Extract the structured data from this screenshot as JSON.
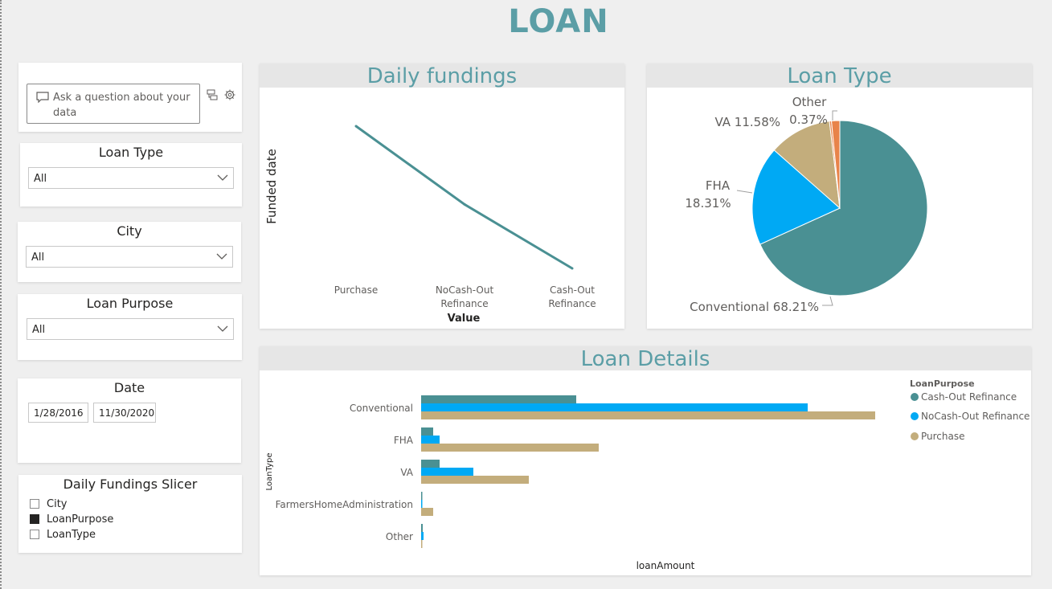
{
  "page_title": "LOAN",
  "qa": {
    "placeholder": "Ask a question about your data"
  },
  "slicers": {
    "loan_type": {
      "title": "Loan Type",
      "value": "All"
    },
    "city": {
      "title": "City",
      "value": "All"
    },
    "loan_purpose": {
      "title": "Loan Purpose",
      "value": "All"
    },
    "date": {
      "title": "Date",
      "start": "1/28/2016",
      "end": "11/30/2020"
    },
    "daily_fundings": {
      "title": "Daily Fundings Slicer",
      "options": [
        {
          "label": "City",
          "checked": false
        },
        {
          "label": "LoanPurpose",
          "checked": true
        },
        {
          "label": "LoanType",
          "checked": false
        }
      ]
    }
  },
  "chart_data": [
    {
      "type": "line",
      "title": "Daily fundings",
      "xlabel": "Value",
      "ylabel": "Funded date",
      "categories": [
        "Purchase",
        "NoCash-Out Refinance",
        "Cash-Out Refinance"
      ],
      "category_lines": [
        [
          "Purchase"
        ],
        [
          "NoCash-Out",
          "Refinance"
        ],
        [
          "Cash-Out",
          "Refinance"
        ]
      ],
      "values": [
        100,
        45,
        0
      ],
      "color": "#4a9093"
    },
    {
      "type": "pie",
      "title": "Loan Type",
      "slices": [
        {
          "label": "Conventional",
          "value": 68.21,
          "pct_label": "68.21%",
          "color": "#4a9093"
        },
        {
          "label": "FHA",
          "value": 18.31,
          "pct_label": "18.31%",
          "color": "#00a9f4"
        },
        {
          "label": "VA",
          "value": 11.58,
          "pct_label": "11.58%",
          "color": "#c3ad7c"
        },
        {
          "label": "Other",
          "value": 0.37,
          "pct_label": "0.37%",
          "color": "#e8834a"
        },
        {
          "label": "",
          "value": 1.53,
          "pct_label": "",
          "color": "#e8834a"
        }
      ]
    },
    {
      "type": "bar",
      "orientation": "horizontal",
      "title": "Loan Details",
      "xlabel": "loanAmount",
      "ylabel": "LoanType",
      "legend_title": "LoanPurpose",
      "legend_position": "right",
      "categories": [
        "Conventional",
        "FHA",
        "VA",
        "FarmersHomeAdministration",
        "Other"
      ],
      "series": [
        {
          "name": "Cash-Out Refinance",
          "color": "#4a9093",
          "values": [
            193,
            15,
            23,
            0.8,
            2
          ]
        },
        {
          "name": "NoCash-Out Refinance",
          "color": "#00a9f4",
          "values": [
            481,
            23,
            65,
            1,
            3
          ]
        },
        {
          "name": "Purchase",
          "color": "#c3ad7c",
          "values": [
            565,
            221,
            134,
            15,
            0.5
          ]
        }
      ],
      "xlim": [
        0,
        565
      ]
    }
  ]
}
